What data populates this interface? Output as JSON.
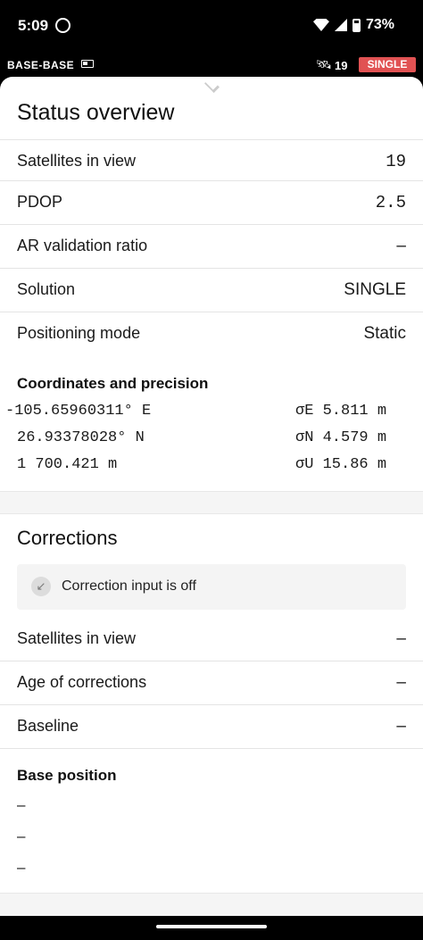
{
  "status_bar": {
    "time": "5:09",
    "battery": "73%"
  },
  "app_bar": {
    "device_name": "BASE-BASE",
    "satellites_icon": "satellite-icon",
    "satellite_count": "19",
    "solution_badge": "SINGLE",
    "badge_color": "#e15253"
  },
  "status_overview": {
    "title": "Status overview",
    "rows": [
      {
        "label": "Satellites in view",
        "value": "19"
      },
      {
        "label": "PDOP",
        "value": "2.5"
      },
      {
        "label": "AR validation ratio",
        "value": "–"
      },
      {
        "label": "Solution",
        "value": "SINGLE"
      },
      {
        "label": "Positioning mode",
        "value": "Static"
      }
    ],
    "coords_title": "Coordinates and precision",
    "coords": [
      {
        "value": "-105.65960311° E",
        "sigma": "σE 5.811 m"
      },
      {
        "value": "26.93378028° N",
        "sigma": "σN 4.579 m"
      },
      {
        "value": "1 700.421 m",
        "sigma": "σU 15.86 m"
      }
    ]
  },
  "corrections": {
    "title": "Corrections",
    "info_icon": "arrow-down-left-icon",
    "info_text": "Correction input is off",
    "rows": [
      {
        "label": "Satellites in view",
        "value": "–"
      },
      {
        "label": "Age of corrections",
        "value": "–"
      },
      {
        "label": "Baseline",
        "value": "–"
      }
    ],
    "base_title": "Base position",
    "base_lines": [
      "–",
      "–",
      "–"
    ]
  }
}
